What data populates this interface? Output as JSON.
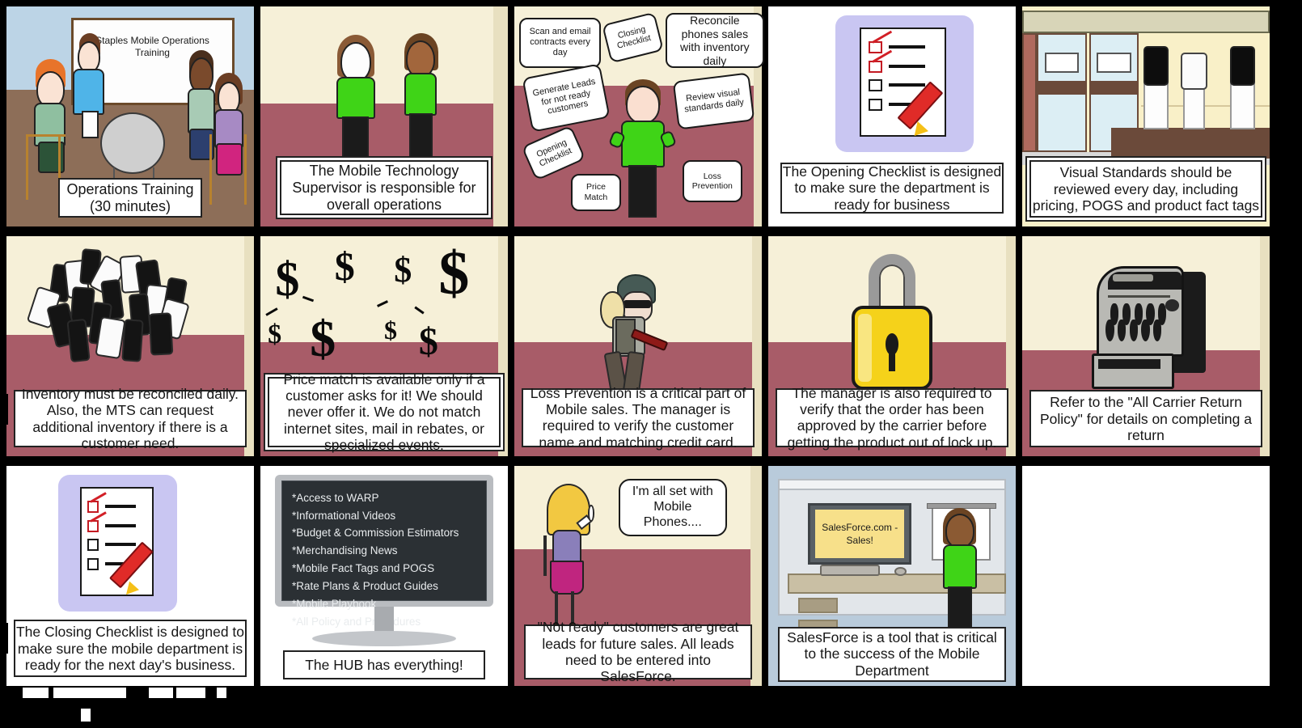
{
  "meta": {
    "type": "storyboard",
    "title": "Staples Mobile Operations Training",
    "rows": 3,
    "columns": 5,
    "background_color": "#000000",
    "panel_floor_color": "#a85c68",
    "panel_wall_color": "#f6f0d8",
    "uniform_color": "#3fd417"
  },
  "panels": [
    {
      "id": "panel-1",
      "scene": "classroom-training",
      "whiteboard_text": "Staples Mobile Operations Training",
      "caption": "Operations Training (30 minutes)"
    },
    {
      "id": "panel-2",
      "scene": "two-associates-standing",
      "caption": "The Mobile Technology Supervisor is responsible for overall operations"
    },
    {
      "id": "panel-3",
      "scene": "supervisor-with-task-bubbles",
      "bubbles": [
        "Scan and email contracts every day",
        "Closing Checklist",
        "Reconcile phones sales with inventory daily",
        "Generate Leads for not ready customers",
        "Review visual standards daily",
        "Opening Checklist",
        "Price Match",
        "Loss Prevention"
      ],
      "caption": ""
    },
    {
      "id": "panel-4",
      "scene": "opening-checklist-icon",
      "caption": "The Opening Checklist is designed to make sure the department is ready for business"
    },
    {
      "id": "panel-5",
      "scene": "store-front-display",
      "caption": "Visual Standards should be reviewed every day, including pricing, POGS and product fact tags"
    },
    {
      "id": "panel-6",
      "scene": "pile-of-phones-and-tablets",
      "caption": "Inventory must be reconciled daily. Also, the MTS can request additional inventory if there is a customer need."
    },
    {
      "id": "panel-7",
      "scene": "dollar-signs",
      "caption": "Price match is available only if a customer asks for it! We should never offer it. We do not match internet sites, mail in rebates, or specialized events."
    },
    {
      "id": "panel-8",
      "scene": "thief-with-crowbar",
      "caption": "Loss Prevention is a critical part of Mobile sales. The manager is required to verify the customer name and matching credit card."
    },
    {
      "id": "panel-9",
      "scene": "yellow-padlock",
      "caption": "The manager is also required to verify that the order has been approved by the carrier before getting the product out of lock up."
    },
    {
      "id": "panel-10",
      "scene": "cash-register",
      "caption": "Refer to the \"All Carrier Return Policy\" for details on completing a return"
    },
    {
      "id": "panel-11",
      "scene": "closing-checklist-icon",
      "caption": "The Closing Checklist is designed to make sure the mobile department is ready for the next day's business."
    },
    {
      "id": "panel-12",
      "scene": "hub-monitor",
      "screen_items": [
        "*Access to WARP",
        "*Informational Videos",
        "*Budget & Commission Estimators",
        "*Merchandising News",
        "*Mobile Fact Tags and POGS",
        "*Rate Plans & Product Guides",
        "*Mobile Playbook",
        "*All Policy and Procedures"
      ],
      "caption": "The HUB has everything!"
    },
    {
      "id": "panel-13",
      "scene": "customer-with-speech-bubble",
      "speech_bubble": "I'm all set with Mobile Phones....",
      "caption": "\"Not ready\" customers are great leads for future sales. All leads need to be entered into SalesForce."
    },
    {
      "id": "panel-14",
      "scene": "salesforce-workstation",
      "screen_text": "SalesForce.com - Sales!",
      "caption": "SalesForce is a tool that is critical to the success of the Mobile Department"
    },
    {
      "id": "panel-15",
      "scene": "empty-panel",
      "caption": ""
    }
  ]
}
